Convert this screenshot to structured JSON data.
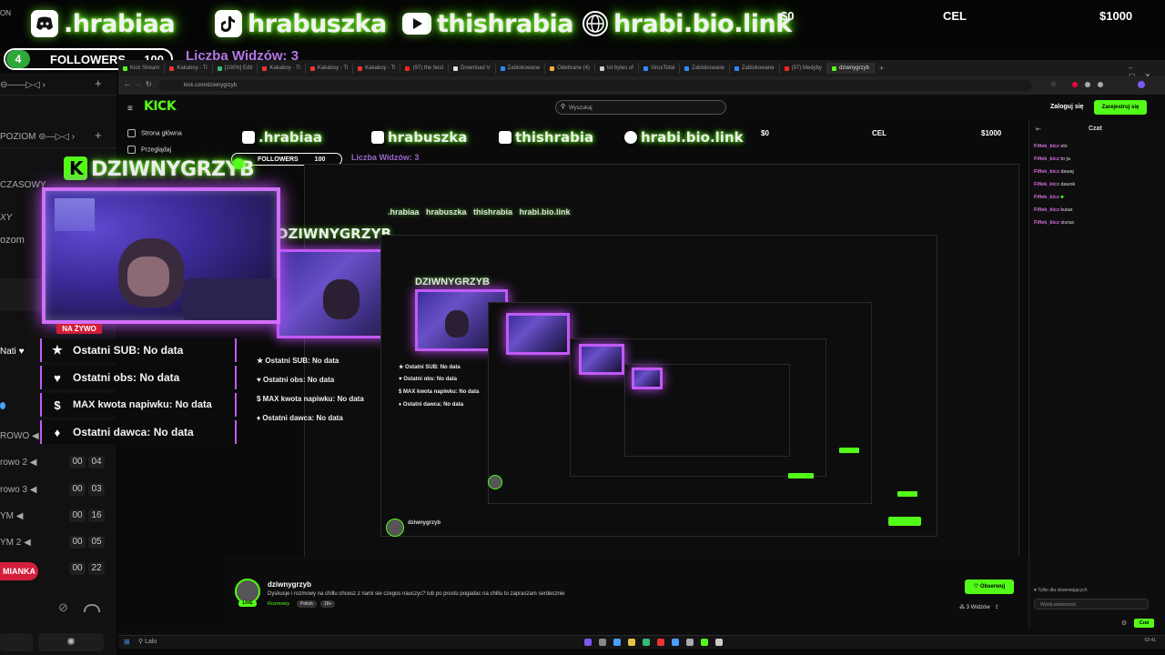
{
  "overlay": {
    "discord": ".hrabiaa",
    "tiktok": "hrabuszka",
    "youtube": "thishrabia",
    "link": "hrabi.bio.link",
    "goal_start": "$0",
    "goal_label": "CEL",
    "goal_end": "$1000",
    "followers_count": "4",
    "followers_label": "FOLLOWERS",
    "followers_goal": "100",
    "viewers": "Liczba Widzów: 3",
    "streamer_name": "DZIWNYGRZYB",
    "live_tag": "NA ŻYWO",
    "stats": [
      {
        "icon": "★",
        "text": "Ostatni SUB: No data"
      },
      {
        "icon": "♥",
        "text": "Ostatni obs: No data"
      },
      {
        "icon": "$",
        "text": "MAX kwota napiwku: No data"
      },
      {
        "icon": "♦",
        "text": "Ostatni dawca: No data"
      }
    ]
  },
  "left_dock": {
    "corner": "ON",
    "rows": [
      "POZIOM",
      "CZASOWY",
      "XY",
      "ozom",
      "Nati",
      "ROWO",
      "rowo 2",
      "rowo 3",
      "YM",
      "YM 2"
    ],
    "times": [
      [
        "00",
        "04"
      ],
      [
        "00",
        "03"
      ],
      [
        "00",
        "16"
      ],
      [
        "00",
        "05"
      ],
      [
        "00",
        "22"
      ]
    ],
    "badge": "MIANKA"
  },
  "browser": {
    "tabs": [
      "Kick Stream",
      "Kakaboy - Ti",
      "[100%] Edit",
      "Kakaboy - Ti",
      "Kakaboy - Ti",
      "Kakaboy - Ti",
      "(97) the best",
      "Download V",
      "Zablokowane",
      "Odebrane (4)",
      "lot bytes of",
      "VirusTotal",
      "Zablokowane",
      "Zablokowane",
      "(97) Medyby",
      "dziwnygrzyb"
    ],
    "url": "kick.com/dziwnygrzyb",
    "search_placeholder": "Wyszukaj",
    "login": "Zaloguj się",
    "register": "Zarejestruj się",
    "nav": [
      "Strona główna",
      "Przeglądaj"
    ],
    "logo": "KICK"
  },
  "stream": {
    "streamer": "dziwnygrzyb",
    "description": "Dyskusje i rozmowy na chillu chcesz z nami sie czegos nauczyc? lub po prostu pogadac na chillu to zapraszam serdecznie",
    "category": "Rozmowy",
    "tags": [
      "Polish",
      "18+"
    ],
    "follow": "Obserwuj",
    "viewers": "3 Widzów",
    "live": "LIVE"
  },
  "chat": {
    "title": "Czat",
    "messages": [
      {
        "user": "Fiflek_kicz",
        "text": "elo"
      },
      {
        "user": "Fiflek_kicz",
        "text": "to ja"
      },
      {
        "user": "Fiflek_kicz",
        "text": "dawaj"
      },
      {
        "user": "Fiflek_kicz",
        "text": "dawok"
      },
      {
        "user": "Fiflek_kicz",
        "text": "■"
      },
      {
        "user": "Fiflek_kicz",
        "text": "kutas"
      },
      {
        "user": "Fiflek_kicz",
        "text": "siuras"
      }
    ],
    "subscribers_only": "Tylko dla obserwujących",
    "input_placeholder": "Wyślij wiadomość",
    "send": "Czat"
  },
  "taskbar": {
    "search": "Lalo",
    "time": "02:41"
  },
  "colors": {
    "kick_green": "#53fc18",
    "purple": "#c25af5",
    "live_red": "#d21e3a"
  }
}
